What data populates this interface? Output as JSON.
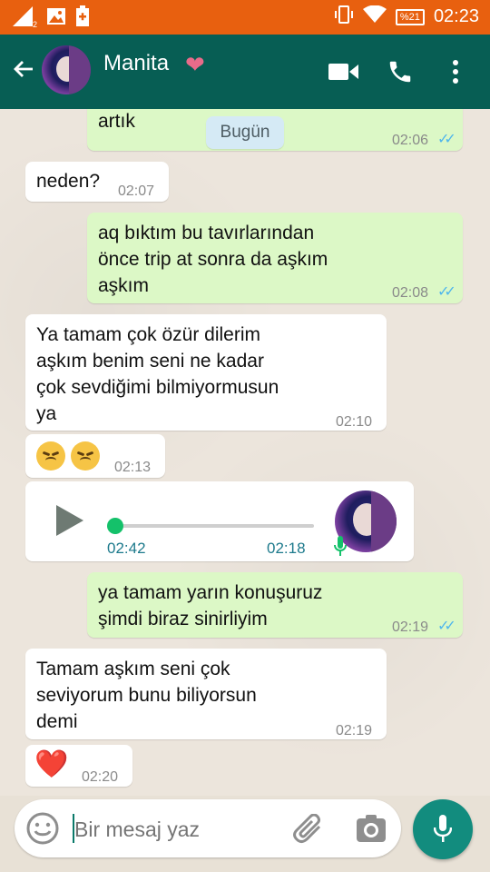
{
  "status_bar": {
    "time": "02:23",
    "battery": "%21",
    "signal_badge": "2",
    "icons": [
      "signal-icon",
      "image-icon",
      "battery-saver-icon",
      "vibrate-icon",
      "wifi-icon",
      "battery-icon"
    ]
  },
  "header": {
    "contact_name": "Manita",
    "name_emoji": "❤",
    "icons": [
      "back-arrow-icon",
      "video-call-icon",
      "phone-icon",
      "more-vert-icon"
    ]
  },
  "chat": {
    "day_chip": "Bugün",
    "messages": [
      {
        "dir": "out",
        "text": "bana aşkım felan deme yeter\nartık",
        "time": "02:06",
        "ticks": "✓✓"
      },
      {
        "dir": "in",
        "text": "neden?",
        "time": "02:07"
      },
      {
        "dir": "out",
        "text": "aq bıktım bu tavırlarından\nönce trip at sonra da aşkım\naşkım",
        "time": "02:08",
        "ticks": "✓✓"
      },
      {
        "dir": "in",
        "text": "Ya tamam çok özür dilerim\naşkım benim seni ne kadar\nçok sevdiğimi bilmiyormusun\nya",
        "time": "02:10"
      },
      {
        "dir": "in",
        "text": "😞😞",
        "time": "02:13"
      },
      {
        "dir": "in",
        "type": "voice",
        "position": "02:42",
        "duration": "02:18",
        "progress": 0.0
      },
      {
        "dir": "out",
        "text": "ya tamam yarın konuşuruz\nşimdi biraz sinirliyim",
        "time": "02:19",
        "ticks": "✓✓"
      },
      {
        "dir": "in",
        "text": "Tamam aşkım seni çok\nseviyorum bunu biliyorsun\ndemi",
        "time": "02:19"
      },
      {
        "dir": "in",
        "text": "❤️",
        "time": "02:20"
      }
    ]
  },
  "composer": {
    "placeholder": "Bir mesaj yaz"
  },
  "colors": {
    "status_bar": "#e8600f",
    "app_bar": "#075e54",
    "outgoing_bubble": "#dcf8c6",
    "incoming_bubble": "#ffffff",
    "accent": "#128c7e"
  }
}
